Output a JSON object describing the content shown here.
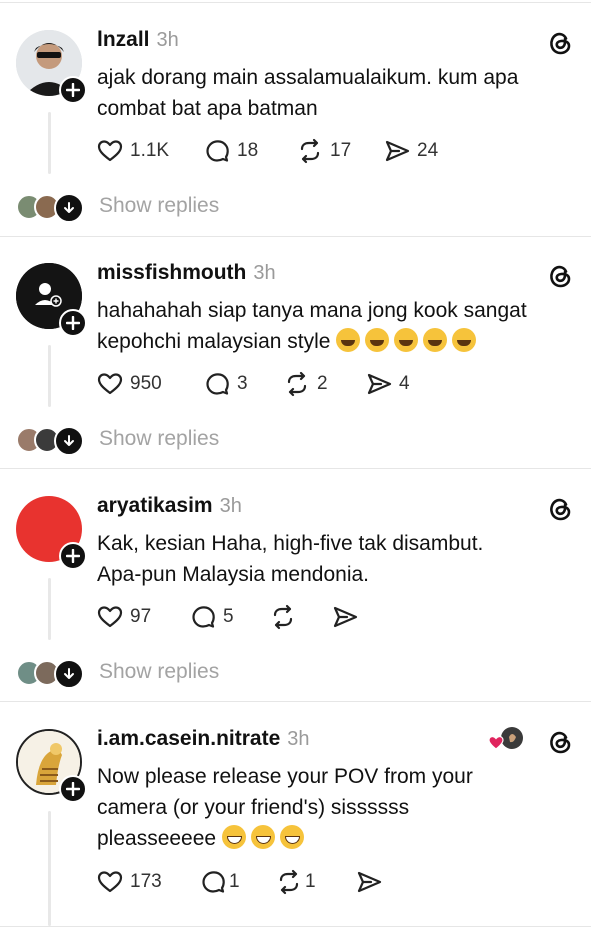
{
  "posts": [
    {
      "username": "lnzall",
      "time": "3h",
      "lines": [
        "ajak dorang main assalamualaikum. kum apa",
        "combat bat apa batman"
      ],
      "emoji_count": 0,
      "likes": "1.1K",
      "comments": "18",
      "reposts": "17",
      "shares": "24",
      "show_replies": "Show replies",
      "avatar": "photo-avatar"
    },
    {
      "username": "missfishmouth",
      "time": "3h",
      "lines": [
        "hahahahah siap tanya mana jong kook sangat",
        "kepohchi malaysian style"
      ],
      "emoji_count": 5,
      "likes": "950",
      "comments": "3",
      "reposts": "2",
      "shares": "4",
      "show_replies": "Show replies",
      "avatar": "default-avatar"
    },
    {
      "username": "aryatikasim",
      "time": "3h",
      "lines": [
        "Kak, kesian Haha, high-five tak disambut.",
        "Apa-pun Malaysia mendonia."
      ],
      "emoji_count": 0,
      "likes": "97",
      "comments": "5",
      "reposts": "",
      "shares": "",
      "show_replies": "Show replies",
      "avatar": "red-avatar"
    },
    {
      "username": "i.am.casein.nitrate",
      "time": "3h",
      "lines": [
        "Now please release your POV from your",
        "camera (or your friend's) sissssss",
        "pleasseeeee"
      ],
      "emoji_count": 3,
      "likes": "173",
      "comments": "1",
      "reposts": "1",
      "shares": "",
      "show_replies": "",
      "avatar": "illustration-avatar"
    }
  ],
  "colors": {
    "text": "#111111",
    "muted": "#9a9a9a",
    "divider": "#e6e6e6",
    "like_heart": "#e0245e"
  }
}
